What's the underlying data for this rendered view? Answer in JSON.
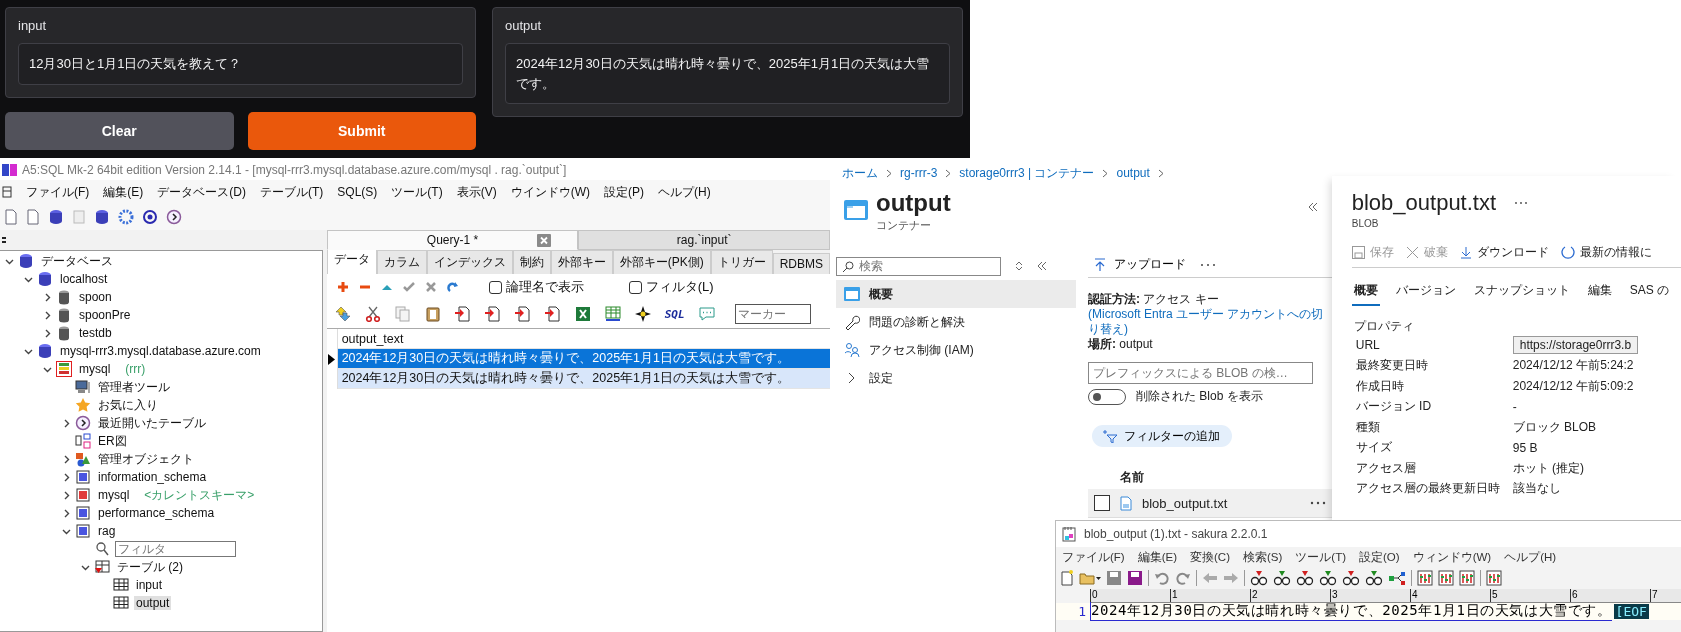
{
  "chat_app": {
    "input": {
      "label": "input",
      "value": "12月30日と1月1日の天気を教えて？"
    },
    "output": {
      "label": "output",
      "value": "2024年12月30日の天気は晴れ時々曇りで、2025年1月1日の天気は大雪です。"
    },
    "buttons": [
      {
        "label": "Clear",
        "kind": "secondary"
      },
      {
        "label": "Submit",
        "kind": "primary"
      }
    ]
  },
  "sql_client": {
    "title": "A5:SQL Mk-2 64bit edition Version 2.14.1 - [mysql-rrr3.mysql.database.azure.com/mysql . rag.`output`]",
    "menu": [
      "ファイル(F)",
      "編集(E)",
      "データベース(D)",
      "テーブル(T)",
      "SQL(S)",
      "ツール(T)",
      "表示(V)",
      "ウインドウ(W)",
      "設定(P)",
      "ヘルプ(H)"
    ],
    "tree": [
      {
        "label": "データベース",
        "kind": "databases",
        "expanded": true,
        "children": [
          {
            "label": "localhost",
            "kind": "server",
            "expanded": true,
            "children": [
              {
                "label": "spoon",
                "kind": "db",
                "expanded": false
              },
              {
                "label": "spoonPre",
                "kind": "db",
                "expanded": false
              },
              {
                "label": "testdb",
                "kind": "db",
                "expanded": false
              }
            ]
          },
          {
            "label": "mysql-rrr3.mysql.database.azure.com",
            "kind": "server",
            "expanded": true,
            "children": [
              {
                "label": "mysql",
                "note": "(rrr)",
                "kind": "connection",
                "expanded": true,
                "children": [
                  {
                    "label": "管理者ツール",
                    "kind": "tools"
                  },
                  {
                    "label": "お気に入り",
                    "kind": "star"
                  },
                  {
                    "label": "最近開いたテーブル",
                    "kind": "clock",
                    "expanded": false
                  },
                  {
                    "label": "ER図",
                    "kind": "er"
                  },
                  {
                    "label": "管理オブジェクト",
                    "kind": "objects",
                    "expanded": false
                  },
                  {
                    "label": "information_schema",
                    "kind": "schema",
                    "expanded": false
                  },
                  {
                    "label": "mysql",
                    "note": "<カレントスキーマ>",
                    "kind": "current-schema",
                    "expanded": false
                  },
                  {
                    "label": "performance_schema",
                    "kind": "schema",
                    "expanded": false
                  },
                  {
                    "label": "rag",
                    "kind": "schema",
                    "expanded": true,
                    "children": [
                      {
                        "placeholder": "フィルタ",
                        "kind": "filter"
                      },
                      {
                        "label": "テーブル (2)",
                        "kind": "tables",
                        "expanded": true,
                        "children": [
                          {
                            "label": "input",
                            "kind": "table",
                            "selected": false
                          },
                          {
                            "label": "output",
                            "kind": "table",
                            "selected": true
                          }
                        ]
                      }
                    ]
                  }
                ]
              }
            ]
          }
        ]
      }
    ],
    "query_tabs": [
      {
        "label": "Query-1 *",
        "selected": true,
        "closable": true
      },
      {
        "label": "rag.`input`",
        "selected": false,
        "closable": false
      }
    ],
    "sub_tabs": [
      {
        "label": "データ",
        "selected": true
      },
      {
        "label": "カラム",
        "selected": false
      },
      {
        "label": "インデックス",
        "selected": false
      },
      {
        "label": "制約",
        "selected": false
      },
      {
        "label": "外部キー",
        "selected": false
      },
      {
        "label": "外部キー(PK側)",
        "selected": false
      },
      {
        "label": "トリガー",
        "selected": false
      },
      {
        "label": "RDBMS",
        "selected": false
      }
    ],
    "checkboxes": [
      {
        "label": "論理名で表示",
        "checked": false
      },
      {
        "label": "フィルタ(L)",
        "checked": false
      }
    ],
    "sql_button": "SQL",
    "marker": {
      "placeholder": "マーカー"
    },
    "grid": {
      "columns": [
        "output_text"
      ],
      "rows": [
        {
          "cells": [
            "2024年12月30日の天気は晴れ時々曇りで、2025年1月1日の天気は大雪です。"
          ],
          "selected": true,
          "current": true
        },
        {
          "cells": [
            "2024年12月30日の天気は晴れ時々曇りで、2025年1月1日の天気は大雪です。"
          ],
          "selected": true,
          "current": false
        }
      ]
    }
  },
  "storage_portal": {
    "breadcrumb": [
      "ホーム",
      "rg-rrr-3",
      "storage0rrr3 | コンテナー",
      "output"
    ],
    "container": {
      "title": "output",
      "subtitle": "コンテナー"
    },
    "search": {
      "placeholder": "検索"
    },
    "nav": [
      {
        "label": "概要",
        "kind": "overview",
        "selected": true
      },
      {
        "label": "問題の診断と解決",
        "kind": "wrench",
        "selected": false
      },
      {
        "label": "アクセス制御 (IAM)",
        "kind": "people",
        "selected": false
      },
      {
        "label": "設定",
        "kind": "group",
        "selected": false
      }
    ],
    "upload": "アップロード",
    "auth": {
      "label": "認証方法:",
      "value": "アクセス キー",
      "link": "(Microsoft Entra ユーザー アカウントへの切り替え)"
    },
    "location": {
      "label": "場所:",
      "value": "output"
    },
    "prefix_search": {
      "placeholder": "プレフィックスによる BLOB の検…"
    },
    "show_deleted": {
      "label": "削除された Blob を表示",
      "on": false
    },
    "add_filter": "フィルターの追加",
    "list": {
      "columns": [
        "名前"
      ],
      "rows": [
        {
          "name": "blob_output.txt",
          "checked": false
        }
      ]
    },
    "blob": {
      "title": "blob_output.txt",
      "type": "BLOB",
      "commands": [
        {
          "label": "保存",
          "kind": "save",
          "disabled": true
        },
        {
          "label": "破棄",
          "kind": "discard",
          "disabled": true
        },
        {
          "label": "ダウンロード",
          "kind": "download",
          "disabled": false
        },
        {
          "label": "最新の情報に",
          "kind": "refresh",
          "disabled": false
        }
      ],
      "tabs": [
        {
          "label": "概要",
          "selected": true
        },
        {
          "label": "バージョン",
          "selected": false
        },
        {
          "label": "スナップショット",
          "selected": false
        },
        {
          "label": "編集",
          "selected": false
        },
        {
          "label": "SAS の",
          "selected": false
        }
      ],
      "section": "プロパティ",
      "properties": [
        {
          "label": "URL",
          "value": "https://storage0rrr3.b",
          "kind": "field"
        },
        {
          "label": "最終変更日時",
          "value": "2024/12/12 午前5:24:2",
          "kind": "text"
        },
        {
          "label": "作成日時",
          "value": "2024/12/12 午前5:09:2",
          "kind": "text"
        },
        {
          "label": "バージョン ID",
          "value": "-",
          "kind": "text"
        },
        {
          "label": "種類",
          "value": "ブロック BLOB",
          "kind": "text"
        },
        {
          "label": "サイズ",
          "value": "95 B",
          "kind": "text"
        },
        {
          "label": "アクセス層",
          "value": "ホット (推定)",
          "kind": "text"
        },
        {
          "label": "アクセス層の最終更新日時",
          "value": "該当なし",
          "kind": "text"
        }
      ]
    }
  },
  "text_editor": {
    "title": "blob_output (1).txt - sakura 2.2.0.1",
    "menu": [
      "ファイル(F)",
      "編集(E)",
      "変換(C)",
      "検索(S)",
      "ツール(T)",
      "設定(O)",
      "ウィンドウ(W)",
      "ヘルプ(H)"
    ],
    "ruler": [
      "0",
      "1",
      "2",
      "3",
      "4",
      "5",
      "6",
      "7"
    ],
    "lines": [
      {
        "number": "1",
        "text": "2024年12月30日の天気は晴れ時々曇りで、2025年1月1日の天気は大雪です。",
        "eof": "[EOF"
      }
    ]
  }
}
